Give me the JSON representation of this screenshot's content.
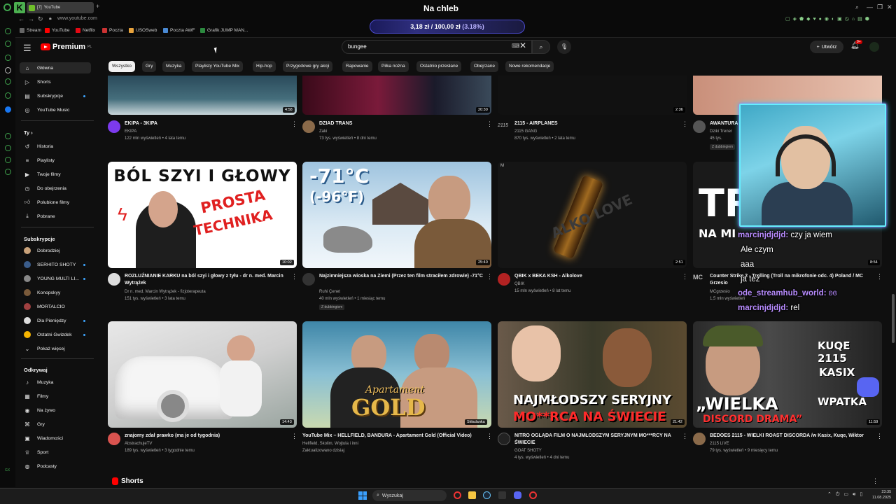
{
  "browser": {
    "tab_title": "YouTube",
    "tab_count": "[7]",
    "url": "www.youtube.com",
    "bookmarks": [
      "Stream",
      "YouTube",
      "Netflix",
      "Poczta",
      "USOSweb",
      "Poczta AWF",
      "Grafik JUMP MAN..."
    ]
  },
  "overlay": {
    "title": "Na chleb",
    "goal": "3,18 zł / 100,00 zł",
    "percent": "(3.18%)"
  },
  "masthead": {
    "logo": "Premium",
    "logo_region": "PL",
    "search_value": "bungee",
    "create_label": "Utwórz",
    "notif_count": "9+"
  },
  "chips": [
    "Wszystko",
    "Gry",
    "Muzyka",
    "Playlisty YouTube Mix",
    "Hip-hop",
    "Przygodowe gry akcji",
    "Rapowanie",
    "Piłka nożna",
    "Ostatnio przesłane",
    "Obejrzane",
    "Nowe rekomendacje"
  ],
  "sidebar": {
    "main": [
      {
        "label": "Główna",
        "icon": "home-icon"
      },
      {
        "label": "Shorts",
        "icon": "shorts-icon"
      },
      {
        "label": "Subskrypcje",
        "icon": "subscriptions-icon"
      },
      {
        "label": "YouTube Music",
        "icon": "music-icon"
      }
    ],
    "you_head": "Ty",
    "you": [
      {
        "label": "Historia"
      },
      {
        "label": "Playlisty"
      },
      {
        "label": "Twoje filmy"
      },
      {
        "label": "Do obejrzenia"
      },
      {
        "label": "Polubione filmy"
      },
      {
        "label": "Pobrane"
      }
    ],
    "subs_head": "Subskrypcje",
    "subs": [
      {
        "label": "Dobrodziej",
        "color": "#c9a27a"
      },
      {
        "label": "SERHITO SHOTY",
        "color": "#3a5c8a"
      },
      {
        "label": "YOUNG MULTI LI...",
        "color": "#888"
      },
      {
        "label": "Konopskyy",
        "color": "#7a5a3a"
      },
      {
        "label": "MORTALCIO",
        "color": "#a04040"
      },
      {
        "label": "Dla Pieniędzy",
        "color": "#ddd"
      },
      {
        "label": "Ostatni Gwizdek",
        "color": "#f5b400"
      }
    ],
    "show_more": "Pokaż więcej",
    "explore_head": "Odkrywaj",
    "explore": [
      {
        "label": "Muzyka"
      },
      {
        "label": "Filmy"
      },
      {
        "label": "Na żywo"
      },
      {
        "label": "Gry"
      },
      {
        "label": "Wiadomości"
      },
      {
        "label": "Sport"
      },
      {
        "label": "Podcasty"
      }
    ]
  },
  "videos_row1": [
    {
      "title": "EKIPA - 3KIPA",
      "channel": "EKIPA",
      "meta": "122 mln wyświetleń • 4 lata temu",
      "duration": "4:58"
    },
    {
      "title": "DZIAD TRANS",
      "channel": "Zaki",
      "meta": "73 tys. wyświetleń • 8 dni temu",
      "duration": "20:30"
    },
    {
      "title": "2115 - AIRPLANES",
      "channel": "2115 GANG",
      "meta": "870 tys. wyświetleń • 2 lata temu",
      "duration": "2:36"
    },
    {
      "title": "AWANTURA",
      "channel": "Dziki Trener",
      "meta": "45 tys.",
      "badge": "Z dubbingiem"
    }
  ],
  "videos_row2": [
    {
      "title": "ROZLUŹNIANIE KARKU na ból szyi i głowy z tyłu - dr n. med. Marcin Wytrążek",
      "channel": "Dr n. med. Marcin Wytrążek - fizjoterapeuta",
      "meta": "151 tys. wyświetleń • 3 lata temu",
      "duration": "10:02",
      "thumb_line1": "BÓL SZYI I GŁOWY",
      "thumb_line2": "PROSTA",
      "thumb_line3": "TECHNIKA"
    },
    {
      "title": "Najzimniejsza wioska na Ziemi (Przez ten film straciłem zdrowie) -71°C",
      "channel": "Ruhi Çenet",
      "meta": "40 mln wyświetleń • 1 miesiąc temu",
      "duration": "25:40",
      "badge": "Z dubbingiem",
      "thumb_line1": "-71°C",
      "thumb_line2": "(-96°F)"
    },
    {
      "title": "QBIK x BEKA KSH - Alkolove",
      "channel": "QBIK",
      "meta": "15 mln wyświetleń • 8 lat temu",
      "duration": "2:51",
      "thumb_line1": "ALKO LOVE"
    },
    {
      "title": "Counter Strike 2 - Trolling (Troll na mikrofonie odc. 4) Poland / MC Grzesio",
      "channel": "MCgrzesio",
      "meta": "1,5 mln wyświetleń",
      "duration": "8:54",
      "thumb_line1": "TR",
      "thumb_line2": "NA MI"
    }
  ],
  "videos_row3": [
    {
      "title": "znajomy zdał prawko (ma je od tygodnia)",
      "channel": "AbstrachujeTV",
      "meta": "189 tys. wyświetleń • 3 tygodnie temu",
      "duration": "14:43"
    },
    {
      "title": "YouTube Mix – HELLFIELD, BANDURA - Apartament Gold (Official Video)",
      "channel": "Hellfield, Skolim, Wojtula i inni",
      "meta": "Zaktualizowano dzisiaj",
      "duration": "Składanka",
      "thumb_line1": "Apartament",
      "thumb_line2": "GOLD"
    },
    {
      "title": "NITRO OGLĄDA FILM O NAJMŁODSZYM SERYJNYM MO***RCY NA ŚWIECIE",
      "channel": "GOAT SHOTY",
      "meta": "4 tys. wyświetleń • 4 dni temu",
      "duration": "21:42",
      "thumb_line1": "NAJMŁODSZY SERYJNY",
      "thumb_line2": "MO**RCA NA ŚWIECIE"
    },
    {
      "title": "BEDOES 2115 - WIELKI ROAST DISCORDA /w Kasix, Kuqe, Wiktor",
      "channel": "2115 LIVE",
      "meta": "79 tys. wyświetleń • 9 miesięcy temu",
      "duration": "11:59",
      "thumb_line1": "KUQE 2115",
      "thumb_line2": "KASIX",
      "thumb_line3": "WPATKA",
      "thumb_line4": "„WIELKA",
      "thumb_line5": "DISCORD DRAMA”"
    }
  ],
  "shorts_title": "Shorts",
  "chat": [
    {
      "user": "marcinjdjdjd:",
      "msg": "czy ja wiem"
    },
    {
      "user": "",
      "msg": "Ale czym"
    },
    {
      "user": "",
      "msg": "aaa"
    },
    {
      "user": "",
      "msg": "ja też"
    },
    {
      "user": "ode_streamhub_world:",
      "msg": ""
    },
    {
      "user": "marcinjdjdjd:",
      "msg": "rel"
    }
  ],
  "taskbar": {
    "search": "Wyszukaj",
    "time": "23:35",
    "date": "11.08.2025"
  },
  "colors": {
    "bg": "#0f0f0f",
    "accent": "#ff0000",
    "chip_active": "#f1f1f1",
    "chat_user": "#b88cff"
  }
}
